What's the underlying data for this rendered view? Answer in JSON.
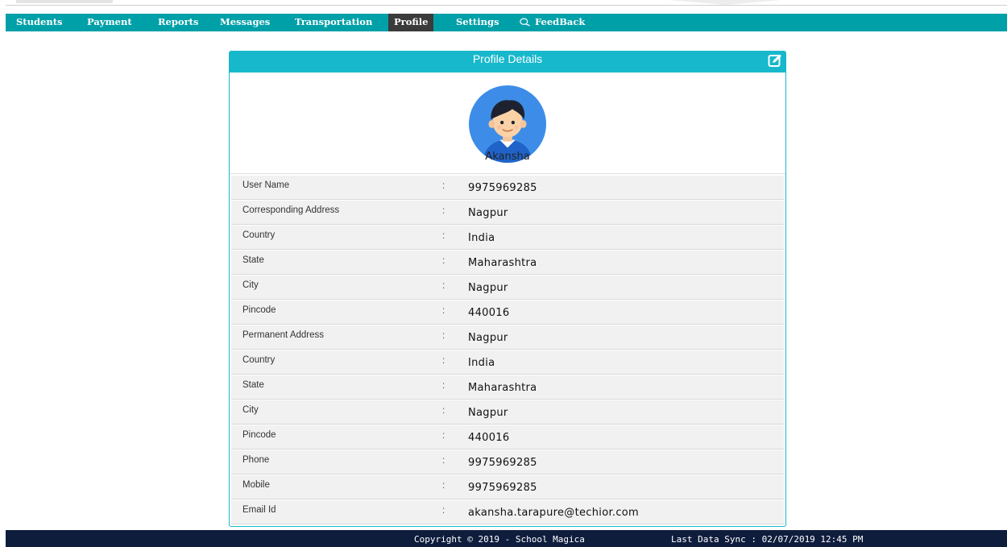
{
  "nav": {
    "items": [
      "Students",
      "Payment",
      "Reports",
      "Messages",
      "Transportation",
      "Profile",
      "Settings",
      "FeedBack"
    ],
    "active": "Profile"
  },
  "panel": {
    "title": "Profile Details",
    "name": "Akansha"
  },
  "profile_rows": [
    {
      "label": "User Name",
      "value": "9975969285"
    },
    {
      "label": "Corresponding Address",
      "value": "Nagpur"
    },
    {
      "label": "Country",
      "value": "India"
    },
    {
      "label": "State",
      "value": "Maharashtra"
    },
    {
      "label": "City",
      "value": "Nagpur"
    },
    {
      "label": "Pincode",
      "value": "440016"
    },
    {
      "label": "Permanent Address",
      "value": "Nagpur"
    },
    {
      "label": "Country",
      "value": "India"
    },
    {
      "label": "State",
      "value": "Maharashtra"
    },
    {
      "label": "City",
      "value": "Nagpur"
    },
    {
      "label": "Pincode",
      "value": "440016"
    },
    {
      "label": "Phone",
      "value": "9975969285"
    },
    {
      "label": "Mobile",
      "value": "9975969285"
    },
    {
      "label": "Email Id",
      "value": "akansha.tarapure@techior.com"
    }
  ],
  "separator": ":",
  "footer": {
    "copyright": "Copyright © 2019 - School Magica",
    "sync": "Last Data Sync : 02/07/2019 12:45 PM"
  },
  "icons": {
    "edit": "edit-icon",
    "feedback": "chat-bubbles-icon",
    "avatar": "user-avatar-icon"
  },
  "colors": {
    "nav_bg": "#00a0a8",
    "nav_active_bg": "#3b3b3b",
    "panel_accent": "#17b8cc",
    "footer_bg": "#0f1d3d",
    "row_bg": "#f1f1f1"
  }
}
